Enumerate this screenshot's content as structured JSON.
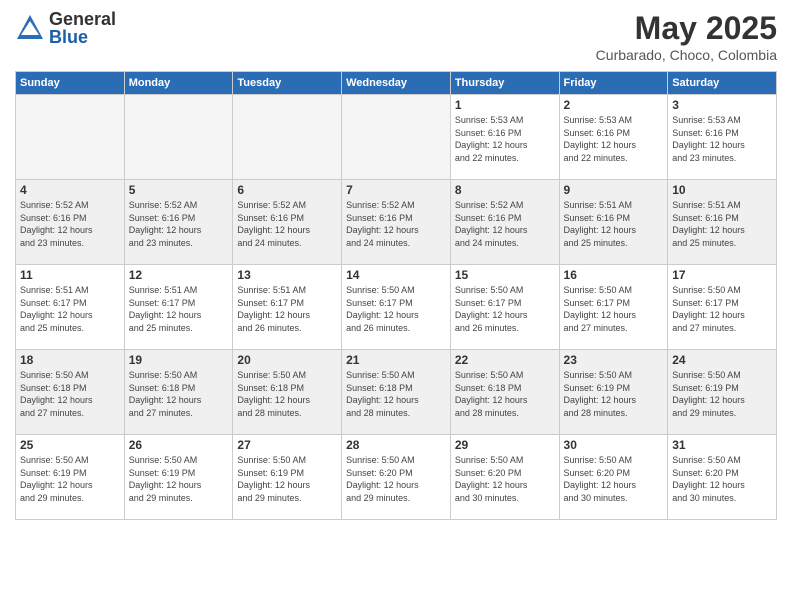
{
  "header": {
    "logo_general": "General",
    "logo_blue": "Blue",
    "month_title": "May 2025",
    "location": "Curbarado, Choco, Colombia"
  },
  "days_of_week": [
    "Sunday",
    "Monday",
    "Tuesday",
    "Wednesday",
    "Thursday",
    "Friday",
    "Saturday"
  ],
  "weeks": [
    [
      {
        "day": "",
        "info": ""
      },
      {
        "day": "",
        "info": ""
      },
      {
        "day": "",
        "info": ""
      },
      {
        "day": "",
        "info": ""
      },
      {
        "day": "1",
        "info": "Sunrise: 5:53 AM\nSunset: 6:16 PM\nDaylight: 12 hours\nand 22 minutes."
      },
      {
        "day": "2",
        "info": "Sunrise: 5:53 AM\nSunset: 6:16 PM\nDaylight: 12 hours\nand 22 minutes."
      },
      {
        "day": "3",
        "info": "Sunrise: 5:53 AM\nSunset: 6:16 PM\nDaylight: 12 hours\nand 23 minutes."
      }
    ],
    [
      {
        "day": "4",
        "info": "Sunrise: 5:52 AM\nSunset: 6:16 PM\nDaylight: 12 hours\nand 23 minutes."
      },
      {
        "day": "5",
        "info": "Sunrise: 5:52 AM\nSunset: 6:16 PM\nDaylight: 12 hours\nand 23 minutes."
      },
      {
        "day": "6",
        "info": "Sunrise: 5:52 AM\nSunset: 6:16 PM\nDaylight: 12 hours\nand 24 minutes."
      },
      {
        "day": "7",
        "info": "Sunrise: 5:52 AM\nSunset: 6:16 PM\nDaylight: 12 hours\nand 24 minutes."
      },
      {
        "day": "8",
        "info": "Sunrise: 5:52 AM\nSunset: 6:16 PM\nDaylight: 12 hours\nand 24 minutes."
      },
      {
        "day": "9",
        "info": "Sunrise: 5:51 AM\nSunset: 6:16 PM\nDaylight: 12 hours\nand 25 minutes."
      },
      {
        "day": "10",
        "info": "Sunrise: 5:51 AM\nSunset: 6:16 PM\nDaylight: 12 hours\nand 25 minutes."
      }
    ],
    [
      {
        "day": "11",
        "info": "Sunrise: 5:51 AM\nSunset: 6:17 PM\nDaylight: 12 hours\nand 25 minutes."
      },
      {
        "day": "12",
        "info": "Sunrise: 5:51 AM\nSunset: 6:17 PM\nDaylight: 12 hours\nand 25 minutes."
      },
      {
        "day": "13",
        "info": "Sunrise: 5:51 AM\nSunset: 6:17 PM\nDaylight: 12 hours\nand 26 minutes."
      },
      {
        "day": "14",
        "info": "Sunrise: 5:50 AM\nSunset: 6:17 PM\nDaylight: 12 hours\nand 26 minutes."
      },
      {
        "day": "15",
        "info": "Sunrise: 5:50 AM\nSunset: 6:17 PM\nDaylight: 12 hours\nand 26 minutes."
      },
      {
        "day": "16",
        "info": "Sunrise: 5:50 AM\nSunset: 6:17 PM\nDaylight: 12 hours\nand 27 minutes."
      },
      {
        "day": "17",
        "info": "Sunrise: 5:50 AM\nSunset: 6:17 PM\nDaylight: 12 hours\nand 27 minutes."
      }
    ],
    [
      {
        "day": "18",
        "info": "Sunrise: 5:50 AM\nSunset: 6:18 PM\nDaylight: 12 hours\nand 27 minutes."
      },
      {
        "day": "19",
        "info": "Sunrise: 5:50 AM\nSunset: 6:18 PM\nDaylight: 12 hours\nand 27 minutes."
      },
      {
        "day": "20",
        "info": "Sunrise: 5:50 AM\nSunset: 6:18 PM\nDaylight: 12 hours\nand 28 minutes."
      },
      {
        "day": "21",
        "info": "Sunrise: 5:50 AM\nSunset: 6:18 PM\nDaylight: 12 hours\nand 28 minutes."
      },
      {
        "day": "22",
        "info": "Sunrise: 5:50 AM\nSunset: 6:18 PM\nDaylight: 12 hours\nand 28 minutes."
      },
      {
        "day": "23",
        "info": "Sunrise: 5:50 AM\nSunset: 6:19 PM\nDaylight: 12 hours\nand 28 minutes."
      },
      {
        "day": "24",
        "info": "Sunrise: 5:50 AM\nSunset: 6:19 PM\nDaylight: 12 hours\nand 29 minutes."
      }
    ],
    [
      {
        "day": "25",
        "info": "Sunrise: 5:50 AM\nSunset: 6:19 PM\nDaylight: 12 hours\nand 29 minutes."
      },
      {
        "day": "26",
        "info": "Sunrise: 5:50 AM\nSunset: 6:19 PM\nDaylight: 12 hours\nand 29 minutes."
      },
      {
        "day": "27",
        "info": "Sunrise: 5:50 AM\nSunset: 6:19 PM\nDaylight: 12 hours\nand 29 minutes."
      },
      {
        "day": "28",
        "info": "Sunrise: 5:50 AM\nSunset: 6:20 PM\nDaylight: 12 hours\nand 29 minutes."
      },
      {
        "day": "29",
        "info": "Sunrise: 5:50 AM\nSunset: 6:20 PM\nDaylight: 12 hours\nand 30 minutes."
      },
      {
        "day": "30",
        "info": "Sunrise: 5:50 AM\nSunset: 6:20 PM\nDaylight: 12 hours\nand 30 minutes."
      },
      {
        "day": "31",
        "info": "Sunrise: 5:50 AM\nSunset: 6:20 PM\nDaylight: 12 hours\nand 30 minutes."
      }
    ]
  ]
}
